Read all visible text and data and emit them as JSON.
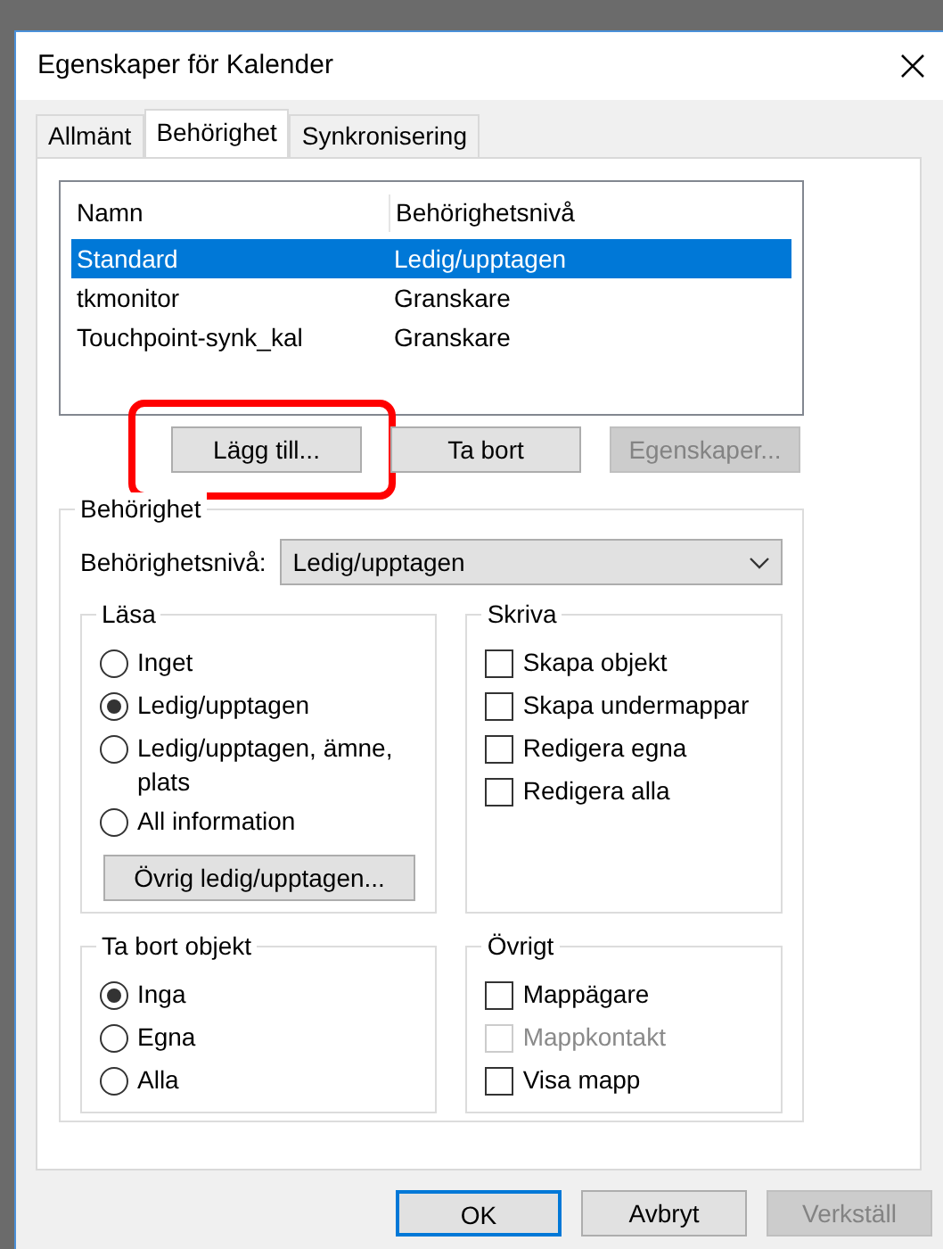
{
  "window": {
    "title": "Egenskaper för Kalender"
  },
  "tabs": [
    {
      "label": "Allmänt",
      "selected": false
    },
    {
      "label": "Behörighet",
      "selected": true
    },
    {
      "label": "Synkronisering",
      "selected": false
    }
  ],
  "permissions_list": {
    "columns": [
      "Namn",
      "Behörighetsnivå"
    ],
    "rows": [
      {
        "name": "Standard",
        "permission": "Ledig/upptagen",
        "selected": true
      },
      {
        "name": "tkmonitor",
        "permission": "Granskare",
        "selected": false
      },
      {
        "name": "Touchpoint-synk_kal",
        "permission": "Granskare",
        "selected": false
      }
    ]
  },
  "list_buttons": [
    {
      "label": "Lägg till...",
      "disabled": false,
      "highlighted": true
    },
    {
      "label": "Ta bort",
      "disabled": false,
      "highlighted": false
    },
    {
      "label": "Egenskaper...",
      "disabled": true,
      "highlighted": false
    }
  ],
  "permission_group": {
    "title": "Behörighet",
    "level_label": "Behörighetsnivå:",
    "level_value": "Ledig/upptagen"
  },
  "read": {
    "title": "Läsa",
    "options": [
      {
        "label": "Inget",
        "selected": false
      },
      {
        "label": "Ledig/upptagen",
        "selected": true
      },
      {
        "label": "Ledig/upptagen, ämne, plats",
        "selected": false
      },
      {
        "label": "All information",
        "selected": false
      }
    ],
    "button": "Övrig ledig/upptagen..."
  },
  "write": {
    "title": "Skriva",
    "items": [
      {
        "label": "Skapa objekt",
        "checked": false,
        "disabled": false
      },
      {
        "label": "Skapa undermappar",
        "checked": false,
        "disabled": false
      },
      {
        "label": "Redigera egna",
        "checked": false,
        "disabled": false
      },
      {
        "label": "Redigera alla",
        "checked": false,
        "disabled": false
      }
    ]
  },
  "delete": {
    "title": "Ta bort objekt",
    "options": [
      {
        "label": "Inga",
        "selected": true
      },
      {
        "label": "Egna",
        "selected": false
      },
      {
        "label": "Alla",
        "selected": false
      }
    ]
  },
  "other": {
    "title": "Övrigt",
    "items": [
      {
        "label": "Mappägare",
        "checked": false,
        "disabled": false
      },
      {
        "label": "Mappkontakt",
        "checked": false,
        "disabled": true
      },
      {
        "label": "Visa mapp",
        "checked": false,
        "disabled": false
      }
    ]
  },
  "footer_buttons": [
    {
      "label": "OK",
      "disabled": false,
      "default": true
    },
    {
      "label": "Avbryt",
      "disabled": false,
      "default": false
    },
    {
      "label": "Verkställ",
      "disabled": true,
      "default": false
    }
  ]
}
